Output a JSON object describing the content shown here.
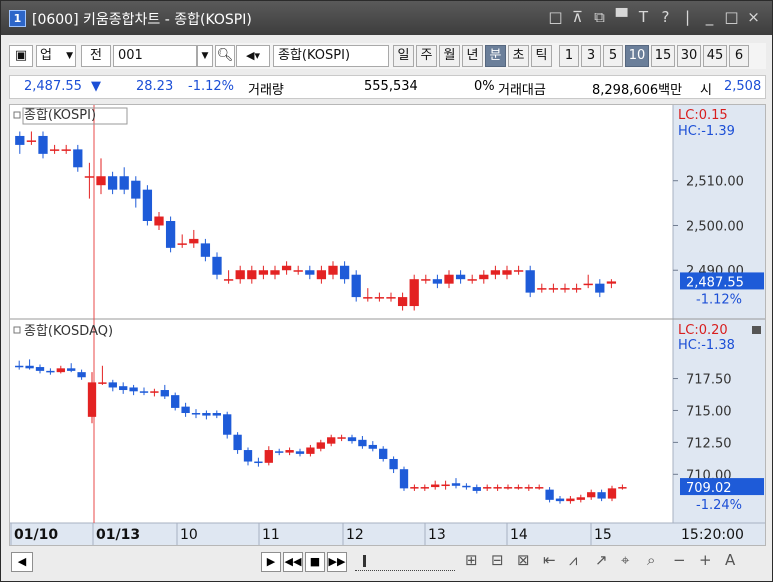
{
  "window": {
    "number": "1",
    "title": "[0600] 키움종합차트 - 종합(KOSPI)",
    "controls": [
      "□",
      "⊼",
      "⧉",
      "▀",
      "T",
      "?",
      "|",
      "_",
      "□",
      "×"
    ]
  },
  "toolbar": {
    "mode": "업",
    "mode2": "전",
    "code": "001",
    "name": "종합(KOSPI)",
    "periods": [
      "일",
      "주",
      "월",
      "년",
      "분",
      "초",
      "틱"
    ],
    "selected_period": "분",
    "intervals": [
      "1",
      "3",
      "5",
      "10",
      "15",
      "30",
      "45",
      "6"
    ],
    "selected_interval": "10"
  },
  "quote": {
    "price": "2,487.55",
    "arrow": "▼",
    "change": "28.23",
    "change_pct": "-1.12%",
    "volume_label": "거래량",
    "volume": "555,534",
    "volume_pct": "0%",
    "amount_label": "거래대금",
    "amount": "8,298,606백만",
    "open_label": "시",
    "open": "2,508"
  },
  "chart_data": [
    {
      "type": "candlestick",
      "title": "종합(KOSPI)",
      "lc": "LC:0.15",
      "hc": "HC:-1.39",
      "ylim": [
        2480,
        2522
      ],
      "yticks": [
        "2,490.00",
        "2,500.00",
        "2,510.00"
      ],
      "current_price": "2,487.55",
      "current_change": "-1.12%",
      "candles": [
        {
          "o": 2520,
          "c": 2518,
          "h": 2521,
          "l": 2516
        },
        {
          "o": 2519,
          "c": 2519,
          "h": 2521,
          "l": 2518
        },
        {
          "o": 2520,
          "c": 2516,
          "h": 2521,
          "l": 2515
        },
        {
          "o": 2517,
          "c": 2517,
          "h": 2518,
          "l": 2516
        },
        {
          "o": 2517,
          "c": 2517,
          "h": 2518,
          "l": 2516
        },
        {
          "o": 2517,
          "c": 2513,
          "h": 2518,
          "l": 2512
        },
        {
          "o": 2511,
          "c": 2511,
          "h": 2514,
          "l": 2506
        },
        {
          "o": 2509,
          "c": 2511,
          "h": 2515,
          "l": 2507
        },
        {
          "o": 2511,
          "c": 2508,
          "h": 2512,
          "l": 2507
        },
        {
          "o": 2511,
          "c": 2508,
          "h": 2513,
          "l": 2507
        },
        {
          "o": 2510,
          "c": 2506,
          "h": 2511,
          "l": 2504
        },
        {
          "o": 2508,
          "c": 2501,
          "h": 2509,
          "l": 2500
        },
        {
          "o": 2500,
          "c": 2502,
          "h": 2503,
          "l": 2499
        },
        {
          "o": 2501,
          "c": 2495,
          "h": 2502,
          "l": 2494
        },
        {
          "o": 2496,
          "c": 2496,
          "h": 2498,
          "l": 2495
        },
        {
          "o": 2496,
          "c": 2497,
          "h": 2499,
          "l": 2495
        },
        {
          "o": 2496,
          "c": 2493,
          "h": 2497,
          "l": 2492
        },
        {
          "o": 2493,
          "c": 2489,
          "h": 2494,
          "l": 2488
        },
        {
          "o": 2488,
          "c": 2488,
          "h": 2490,
          "l": 2487
        },
        {
          "o": 2488,
          "c": 2490,
          "h": 2491,
          "l": 2487
        },
        {
          "o": 2488,
          "c": 2490,
          "h": 2491,
          "l": 2487
        },
        {
          "o": 2489,
          "c": 2490,
          "h": 2491,
          "l": 2488
        },
        {
          "o": 2489,
          "c": 2490,
          "h": 2491,
          "l": 2488
        },
        {
          "o": 2490,
          "c": 2491,
          "h": 2492,
          "l": 2489
        },
        {
          "o": 2490,
          "c": 2490,
          "h": 2491,
          "l": 2489
        },
        {
          "o": 2490,
          "c": 2489,
          "h": 2491,
          "l": 2488
        },
        {
          "o": 2488,
          "c": 2490,
          "h": 2491,
          "l": 2487
        },
        {
          "o": 2489,
          "c": 2491,
          "h": 2492,
          "l": 2488
        },
        {
          "o": 2491,
          "c": 2488,
          "h": 2492,
          "l": 2487
        },
        {
          "o": 2489,
          "c": 2484,
          "h": 2490,
          "l": 2483
        },
        {
          "o": 2484,
          "c": 2484,
          "h": 2486,
          "l": 2483
        },
        {
          "o": 2484,
          "c": 2484,
          "h": 2485,
          "l": 2483
        },
        {
          "o": 2484,
          "c": 2484,
          "h": 2485,
          "l": 2483
        },
        {
          "o": 2482,
          "c": 2484,
          "h": 2485,
          "l": 2481
        },
        {
          "o": 2482,
          "c": 2488,
          "h": 2489,
          "l": 2481
        },
        {
          "o": 2488,
          "c": 2488,
          "h": 2489,
          "l": 2487
        },
        {
          "o": 2488,
          "c": 2487,
          "h": 2489,
          "l": 2486
        },
        {
          "o": 2487,
          "c": 2489,
          "h": 2490,
          "l": 2486
        },
        {
          "o": 2489,
          "c": 2488,
          "h": 2490,
          "l": 2487
        },
        {
          "o": 2488,
          "c": 2488,
          "h": 2489,
          "l": 2487
        },
        {
          "o": 2488,
          "c": 2489,
          "h": 2490,
          "l": 2487
        },
        {
          "o": 2489,
          "c": 2490,
          "h": 2491,
          "l": 2488
        },
        {
          "o": 2489,
          "c": 2490,
          "h": 2491,
          "l": 2488
        },
        {
          "o": 2490,
          "c": 2490,
          "h": 2491,
          "l": 2489
        },
        {
          "o": 2490,
          "c": 2485,
          "h": 2491,
          "l": 2484
        },
        {
          "o": 2486,
          "c": 2486,
          "h": 2487,
          "l": 2485
        },
        {
          "o": 2486,
          "c": 2486,
          "h": 2487,
          "l": 2485
        },
        {
          "o": 2486,
          "c": 2486,
          "h": 2487,
          "l": 2485
        },
        {
          "o": 2486,
          "c": 2486,
          "h": 2487,
          "l": 2485
        },
        {
          "o": 2487,
          "c": 2487,
          "h": 2489,
          "l": 2486
        },
        {
          "o": 2487,
          "c": 2485,
          "h": 2488,
          "l": 2484
        },
        {
          "o": 2487,
          "c": 2487.5,
          "h": 2488,
          "l": 2486
        }
      ]
    },
    {
      "type": "candlestick",
      "title": "종합(KOSDAQ)",
      "lc": "LC:0.20",
      "hc": "HC:-1.38",
      "ylim": [
        706.5,
        719.5
      ],
      "yticks": [
        "710.00",
        "712.50",
        "715.00",
        "717.50"
      ],
      "current_price": "709.02",
      "current_change": "-1.24%",
      "candles": [
        {
          "o": 718.5,
          "c": 718.4,
          "h": 718.9,
          "l": 718.2
        },
        {
          "o": 718.5,
          "c": 718.3,
          "h": 719.0,
          "l": 718.2
        },
        {
          "o": 718.4,
          "c": 718.1,
          "h": 718.6,
          "l": 717.9
        },
        {
          "o": 718.1,
          "c": 718.0,
          "h": 718.3,
          "l": 717.8
        },
        {
          "o": 718.0,
          "c": 718.3,
          "h": 718.5,
          "l": 717.9
        },
        {
          "o": 718.3,
          "c": 718.1,
          "h": 718.7,
          "l": 718.0
        },
        {
          "o": 718.0,
          "c": 717.6,
          "h": 718.2,
          "l": 717.4
        },
        {
          "o": 714.5,
          "c": 717.2,
          "h": 718.0,
          "l": 714.0
        },
        {
          "o": 717.2,
          "c": 717.2,
          "h": 718.5,
          "l": 717.0
        },
        {
          "o": 717.2,
          "c": 716.8,
          "h": 717.4,
          "l": 716.5
        },
        {
          "o": 716.9,
          "c": 716.6,
          "h": 717.2,
          "l": 716.3
        },
        {
          "o": 716.8,
          "c": 716.5,
          "h": 717.0,
          "l": 716.2
        },
        {
          "o": 716.5,
          "c": 716.4,
          "h": 716.8,
          "l": 716.2
        },
        {
          "o": 716.4,
          "c": 716.5,
          "h": 716.7,
          "l": 716.1
        },
        {
          "o": 716.6,
          "c": 716.1,
          "h": 717.0,
          "l": 715.9
        },
        {
          "o": 716.2,
          "c": 715.2,
          "h": 716.4,
          "l": 715.0
        },
        {
          "o": 715.3,
          "c": 714.8,
          "h": 715.6,
          "l": 714.5
        },
        {
          "o": 714.8,
          "c": 714.7,
          "h": 715.1,
          "l": 714.4
        },
        {
          "o": 714.8,
          "c": 714.6,
          "h": 715.0,
          "l": 714.3
        },
        {
          "o": 714.8,
          "c": 714.6,
          "h": 715.0,
          "l": 714.4
        },
        {
          "o": 714.7,
          "c": 713.1,
          "h": 714.9,
          "l": 712.8
        },
        {
          "o": 713.1,
          "c": 711.9,
          "h": 713.3,
          "l": 711.6
        },
        {
          "o": 711.9,
          "c": 711.0,
          "h": 712.1,
          "l": 710.7
        },
        {
          "o": 711.0,
          "c": 710.9,
          "h": 711.3,
          "l": 710.6
        },
        {
          "o": 710.9,
          "c": 711.9,
          "h": 712.2,
          "l": 710.7
        },
        {
          "o": 711.8,
          "c": 711.7,
          "h": 712.0,
          "l": 711.5
        },
        {
          "o": 711.7,
          "c": 711.9,
          "h": 712.1,
          "l": 711.5
        },
        {
          "o": 711.8,
          "c": 711.6,
          "h": 712.0,
          "l": 711.4
        },
        {
          "o": 711.6,
          "c": 712.1,
          "h": 712.3,
          "l": 711.4
        },
        {
          "o": 712.0,
          "c": 712.5,
          "h": 712.7,
          "l": 711.8
        },
        {
          "o": 712.4,
          "c": 712.9,
          "h": 713.1,
          "l": 712.2
        },
        {
          "o": 712.8,
          "c": 712.9,
          "h": 713.1,
          "l": 712.6
        },
        {
          "o": 712.9,
          "c": 712.6,
          "h": 713.1,
          "l": 712.4
        },
        {
          "o": 712.7,
          "c": 712.2,
          "h": 713.0,
          "l": 712.0
        },
        {
          "o": 712.3,
          "c": 712.0,
          "h": 712.6,
          "l": 711.8
        },
        {
          "o": 712.0,
          "c": 711.2,
          "h": 712.2,
          "l": 711.0
        },
        {
          "o": 711.2,
          "c": 710.4,
          "h": 711.4,
          "l": 710.1
        },
        {
          "o": 710.4,
          "c": 708.9,
          "h": 710.6,
          "l": 708.7
        },
        {
          "o": 708.9,
          "c": 709.0,
          "h": 709.2,
          "l": 708.7
        },
        {
          "o": 708.9,
          "c": 709.0,
          "h": 709.2,
          "l": 708.7
        },
        {
          "o": 709.0,
          "c": 709.2,
          "h": 709.5,
          "l": 708.8
        },
        {
          "o": 709.1,
          "c": 709.2,
          "h": 709.5,
          "l": 708.8
        },
        {
          "o": 709.3,
          "c": 709.1,
          "h": 709.7,
          "l": 708.9
        },
        {
          "o": 709.1,
          "c": 709.0,
          "h": 709.3,
          "l": 708.8
        },
        {
          "o": 709.0,
          "c": 708.7,
          "h": 709.2,
          "l": 708.5
        },
        {
          "o": 708.9,
          "c": 709.0,
          "h": 709.2,
          "l": 708.7
        },
        {
          "o": 708.9,
          "c": 709.0,
          "h": 709.2,
          "l": 708.7
        },
        {
          "o": 709.0,
          "c": 709.0,
          "h": 709.2,
          "l": 708.8
        },
        {
          "o": 709.0,
          "c": 709.0,
          "h": 709.2,
          "l": 708.8
        },
        {
          "o": 708.9,
          "c": 709.0,
          "h": 709.2,
          "l": 708.7
        },
        {
          "o": 709.0,
          "c": 709.0,
          "h": 709.2,
          "l": 708.8
        },
        {
          "o": 708.8,
          "c": 708.0,
          "h": 709.0,
          "l": 707.8
        },
        {
          "o": 708.1,
          "c": 707.9,
          "h": 708.3,
          "l": 707.7
        },
        {
          "o": 707.9,
          "c": 708.1,
          "h": 708.3,
          "l": 707.7
        },
        {
          "o": 708.0,
          "c": 708.2,
          "h": 708.4,
          "l": 707.8
        },
        {
          "o": 708.2,
          "c": 708.6,
          "h": 708.8,
          "l": 708.0
        },
        {
          "o": 708.6,
          "c": 708.1,
          "h": 708.8,
          "l": 707.9
        },
        {
          "o": 708.1,
          "c": 708.9,
          "h": 709.1,
          "l": 707.9
        },
        {
          "o": 708.9,
          "c": 709.0,
          "h": 709.2,
          "l": 708.8
        }
      ]
    }
  ],
  "x_axis": {
    "labels": [
      "01/10",
      "01/13",
      "10",
      "11",
      "12",
      "13",
      "14",
      "15"
    ],
    "time": "15:20:00"
  },
  "bottom_tools": [
    "⊞",
    "⊟",
    "⊠",
    "⇤",
    "⩘",
    "↗",
    "⌖",
    "⌕",
    "−",
    "+",
    "A"
  ],
  "colors": {
    "up": "#e32222",
    "down": "#1e5bd8",
    "axis_bg": "#dfe7f2",
    "marker": "#e84a4a"
  }
}
